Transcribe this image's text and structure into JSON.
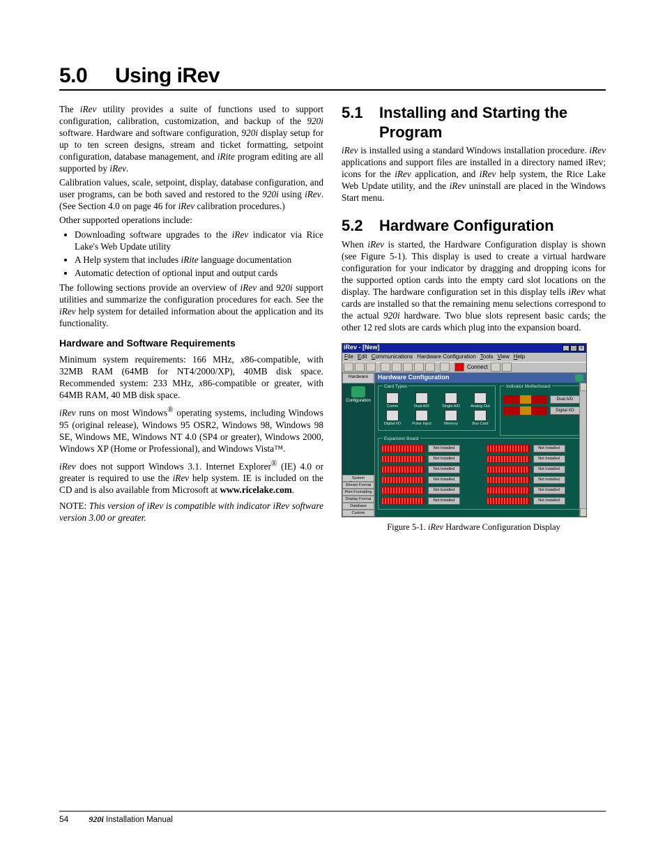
{
  "heading": {
    "number": "5.0",
    "title": "Using iRev"
  },
  "col_left": {
    "intro": "The <i>iRev</i> utility provides a suite of functions used to support configuration, calibration, customization, and backup of the <i>920i</i> software. Hardware and software configuration, <i>920i</i> display setup for up to ten screen designs, stream and ticket formatting, setpoint configuration, database management, and <i>iRite</i> program editing are all supported by <i>iRev</i>.",
    "p2": "Calibration values, scale, setpoint, display, database configuration, and user programs, can be both saved and restored to the <i>920i</i> using <i>iRev</i>. (See Section 4.0 on page 46 for <i>iRev</i> calibration procedures.)",
    "p3": "Other supported operations include:",
    "list1": [
      "Downloading software upgrades to the <i>iRev</i> indicator via Rice Lake's Web Update utility",
      "A Help system that includes <i>iRite</i> language documentation",
      "Automatic detection of optional input and output cards"
    ],
    "p4": "The following sections provide an overview of <i>iRev</i> and <i>920i</i> support utilities and summarize the configuration procedures for each. See the <i>iRev</i> help system for detailed information about the application and its functionality.",
    "sub1_title": "Hardware and Software Requirements",
    "sub1_p1": "Minimum system requirements: 166 MHz, <i>x</i>86-compatible, with 32MB RAM (64MB for NT4/2000/XP), 40MB disk space. Recommended system: 233 MHz, <i>x</i>86-compatible or greater, with 64MB RAM, 40 MB disk space.",
    "sub1_p2": "<i>iRev</i> runs on most Windows<sup>®</sup> operating systems, including Windows 95 (original release), Windows 95 OSR2, Windows 98, Windows 98 SE, Windows ME, Windows NT 4.0 (SP4 or greater), Windows 2000, Windows XP (Home or Professional), and Windows Vista™.",
    "sub1_p3": "<i>iRev</i> does not support Windows 3.1. Internet Explorer<sup>®</sup> (IE) 4.0 or greater is required to use the <i>iRev</i> help system. IE is included on the CD and is also available from Microsoft at <b>www.ricelake.com</b>.",
    "note": "NOTE: <i>This version of iRev is compatible with indicator iRev software version 3.00 or greater.</i>"
  },
  "col_right": {
    "s51": {
      "num": "5.1",
      "title": "Installing and Starting the Program"
    },
    "s51_body": "<i>iRev</i> is installed using a standard Windows installation procedure. <i>iRev</i> applications and support files are installed in a directory named iRev; icons for the <i>iRev</i> application, and <i>iRev</i> help system, the Rice Lake Web Update utility, and the <i>iRev</i> uninstall are placed in the Windows Start menu.",
    "s52": {
      "num": "5.2",
      "title": "Hardware Configuration"
    },
    "s52_body": "When <i>iRev</i> is started, the Hardware Configuration display is shown (see Figure 5-1). This display is used to create a virtual hardware configuration for your indicator by dragging and dropping icons for the supported option cards into the empty card slot locations on the display. The hardware configuration set in this display tells <i>iRev</i> what cards are installed so that the remaining menu selections correspond to the actual <i>920i</i> hardware. Two blue slots represent basic cards; the other 12 red slots are cards which plug into the expansion board.",
    "fig_caption": "Figure 5-1. <i>iRev</i> Hardware Configuration Display",
    "shot": {
      "title": "iRev - [New]",
      "menus": [
        "File",
        "Edit",
        "Communications",
        "Hardware Configuration",
        "Tools",
        "View",
        "Help"
      ],
      "toolbar_connect": "Connect",
      "nav_top": "Hardware",
      "nav_cfg": "Configuration",
      "nav_bottom": [
        "System Parame…",
        "Stream Format",
        "Print Formatting",
        "Display Format",
        "Database",
        "Custom"
      ],
      "main_header": "Hardware Configuration",
      "card_panel": "Card Types",
      "cards_row1": [
        "Comm",
        "Dual A/D",
        "Single A/D",
        "Analog Out"
      ],
      "cards_row2": [
        "Digital I/O",
        "Pulse Input",
        "Memory",
        "Bus Card"
      ],
      "mb_panel": "Indicator Motherboard",
      "mb_slots": [
        "Dual A/D",
        "Digital I/O"
      ],
      "exp_panel": "Expansion Board",
      "exp_label": "Not Installed"
    }
  },
  "footer": {
    "page": "54",
    "title_i": "920i",
    "title_rest": " Installation Manual"
  }
}
